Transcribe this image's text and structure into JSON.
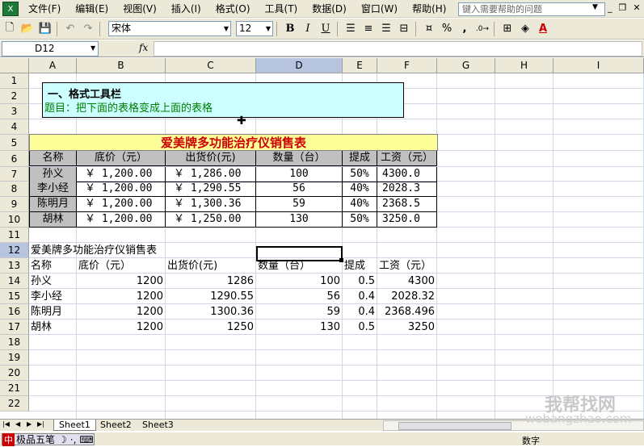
{
  "menu": [
    "文件(F)",
    "编辑(E)",
    "视图(V)",
    "插入(I)",
    "格式(O)",
    "工具(T)",
    "数据(D)",
    "窗口(W)",
    "帮助(H)"
  ],
  "help_placeholder": "键入需要帮助的问题",
  "font_name": "宋体",
  "font_size": "12",
  "toolbar": {
    "bold": "B",
    "italic": "I",
    "underline": "U",
    "percent": "%",
    "comma": ","
  },
  "namebox": "D12",
  "fx_label": "fx",
  "columns": [
    "A",
    "B",
    "C",
    "D",
    "E",
    "F",
    "G",
    "H",
    "I"
  ],
  "rows": [
    "1",
    "2",
    "3",
    "4",
    "5",
    "6",
    "7",
    "8",
    "9",
    "10",
    "11",
    "12",
    "13",
    "14",
    "15",
    "16",
    "17",
    "18",
    "19",
    "20",
    "21",
    "22"
  ],
  "textbox": {
    "title": "一、格式工具栏",
    "desc": "题目：把下面的表格变成上面的表格"
  },
  "banner": "爱美牌多功能治疗仪销售表",
  "formatted_table": {
    "headers": [
      "名称",
      "底价（元）",
      "出货价(元)",
      "数量（台）",
      "提成",
      "工资（元）"
    ],
    "rows": [
      [
        "孙义",
        "￥ 1,200.00",
        "￥ 1,286.00",
        "100",
        "50%",
        "4300.0"
      ],
      [
        "李小经",
        "￥ 1,200.00",
        "￥ 1,290.55",
        "56",
        "40%",
        "2028.3"
      ],
      [
        "陈明月",
        "￥ 1,200.00",
        "￥ 1,300.36",
        "59",
        "40%",
        "2368.5"
      ],
      [
        "胡林",
        "￥ 1,200.00",
        "￥ 1,250.00",
        "130",
        "50%",
        "3250.0"
      ]
    ]
  },
  "raw_table": {
    "title": "爱美牌多功能治疗仪销售表",
    "headers": [
      "名称",
      "底价（元）",
      "出货价(元)",
      "数量（台）",
      "提成",
      "工资（元）"
    ],
    "rows": [
      [
        "孙义",
        "1200",
        "1286",
        "100",
        "0.5",
        "4300"
      ],
      [
        "李小经",
        "1200",
        "1290.55",
        "56",
        "0.4",
        "2028.32"
      ],
      [
        "陈明月",
        "1200",
        "1300.36",
        "59",
        "0.4",
        "2368.496"
      ],
      [
        "胡林",
        "1200",
        "1250",
        "130",
        "0.5",
        "3250"
      ]
    ]
  },
  "sheet_tabs": [
    "Sheet1",
    "Sheet2",
    "Sheet3"
  ],
  "ime_label": "极品五笔",
  "status_text": "数字",
  "watermark": "我帮找网",
  "watermark_url": "wobangzhao.com"
}
